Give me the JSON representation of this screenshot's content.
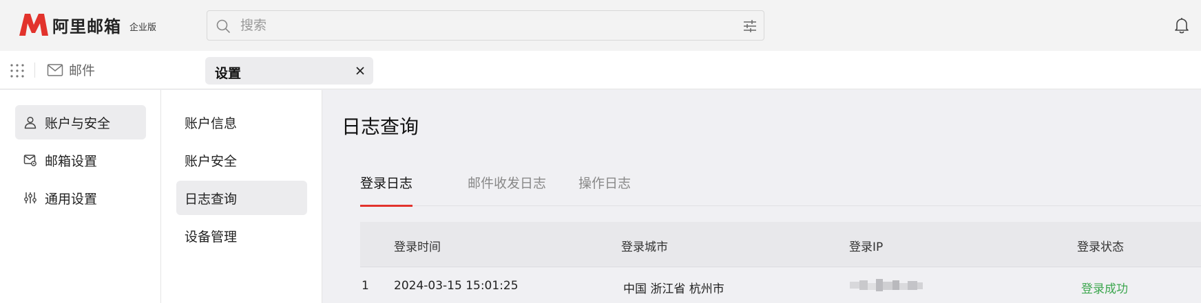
{
  "app": {
    "logo_name": "阿里邮箱",
    "logo_edition": "企业版",
    "brand_color": "#e2332c"
  },
  "search": {
    "placeholder": "搜索",
    "value": ""
  },
  "tabbar": {
    "mail_label": "邮件",
    "settings_tab_label": "设置"
  },
  "left_nav": {
    "items": [
      {
        "label": "账户与安全",
        "icon": "user-icon",
        "active": true
      },
      {
        "label": "邮箱设置",
        "icon": "mailbox-settings-icon",
        "active": false
      },
      {
        "label": "通用设置",
        "icon": "sliders-icon",
        "active": false
      }
    ]
  },
  "sub_nav": {
    "items": [
      {
        "label": "账户信息",
        "active": false
      },
      {
        "label": "账户安全",
        "active": false
      },
      {
        "label": "日志查询",
        "active": true
      },
      {
        "label": "设备管理",
        "active": false
      }
    ]
  },
  "main": {
    "title": "日志查询",
    "tabs": [
      {
        "label": "登录日志",
        "active": true
      },
      {
        "label": "邮件收发日志",
        "active": false
      },
      {
        "label": "操作日志",
        "active": false
      }
    ],
    "table": {
      "columns": [
        "登录时间",
        "登录城市",
        "登录IP",
        "登录状态"
      ],
      "rows": [
        {
          "index": "1",
          "time": "2024-03-15 15:01:25",
          "city": "中国 浙江省 杭州市",
          "status": "登录成功"
        }
      ]
    },
    "status_success_color": "#3ca64e"
  }
}
